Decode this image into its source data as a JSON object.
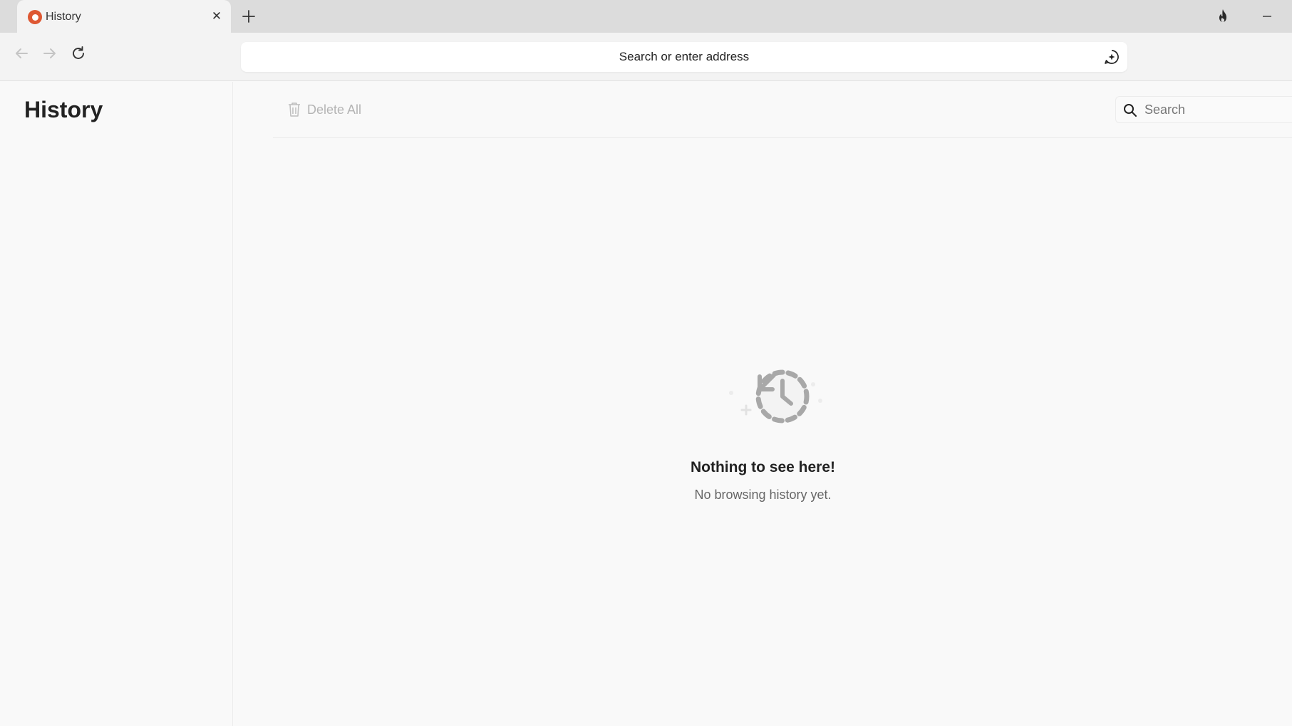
{
  "tabs": [
    {
      "title": "History",
      "close_symbol": "✕",
      "favicon": "duckduckgo-logo"
    }
  ],
  "window_controls": {
    "new_tab_icon": "plus-icon",
    "fire_icon": "fire-icon",
    "minimize_icon": "minimize-icon"
  },
  "toolbar": {
    "back_icon": "arrow-left-icon",
    "forward_icon": "arrow-right-icon",
    "reload_icon": "reload-icon",
    "address_placeholder": "Search or enter address",
    "ai_chat_icon": "ai-chat-icon"
  },
  "sidebar": {
    "title": "History"
  },
  "main": {
    "delete_all_label": "Delete All",
    "search_placeholder": "Search",
    "empty_title": "Nothing to see here!",
    "empty_subtitle": "No browsing history yet."
  },
  "colors": {
    "accent_favicon": "#de5833",
    "disabled_text": "#b4b4b4",
    "background": "#f9f9f9"
  }
}
